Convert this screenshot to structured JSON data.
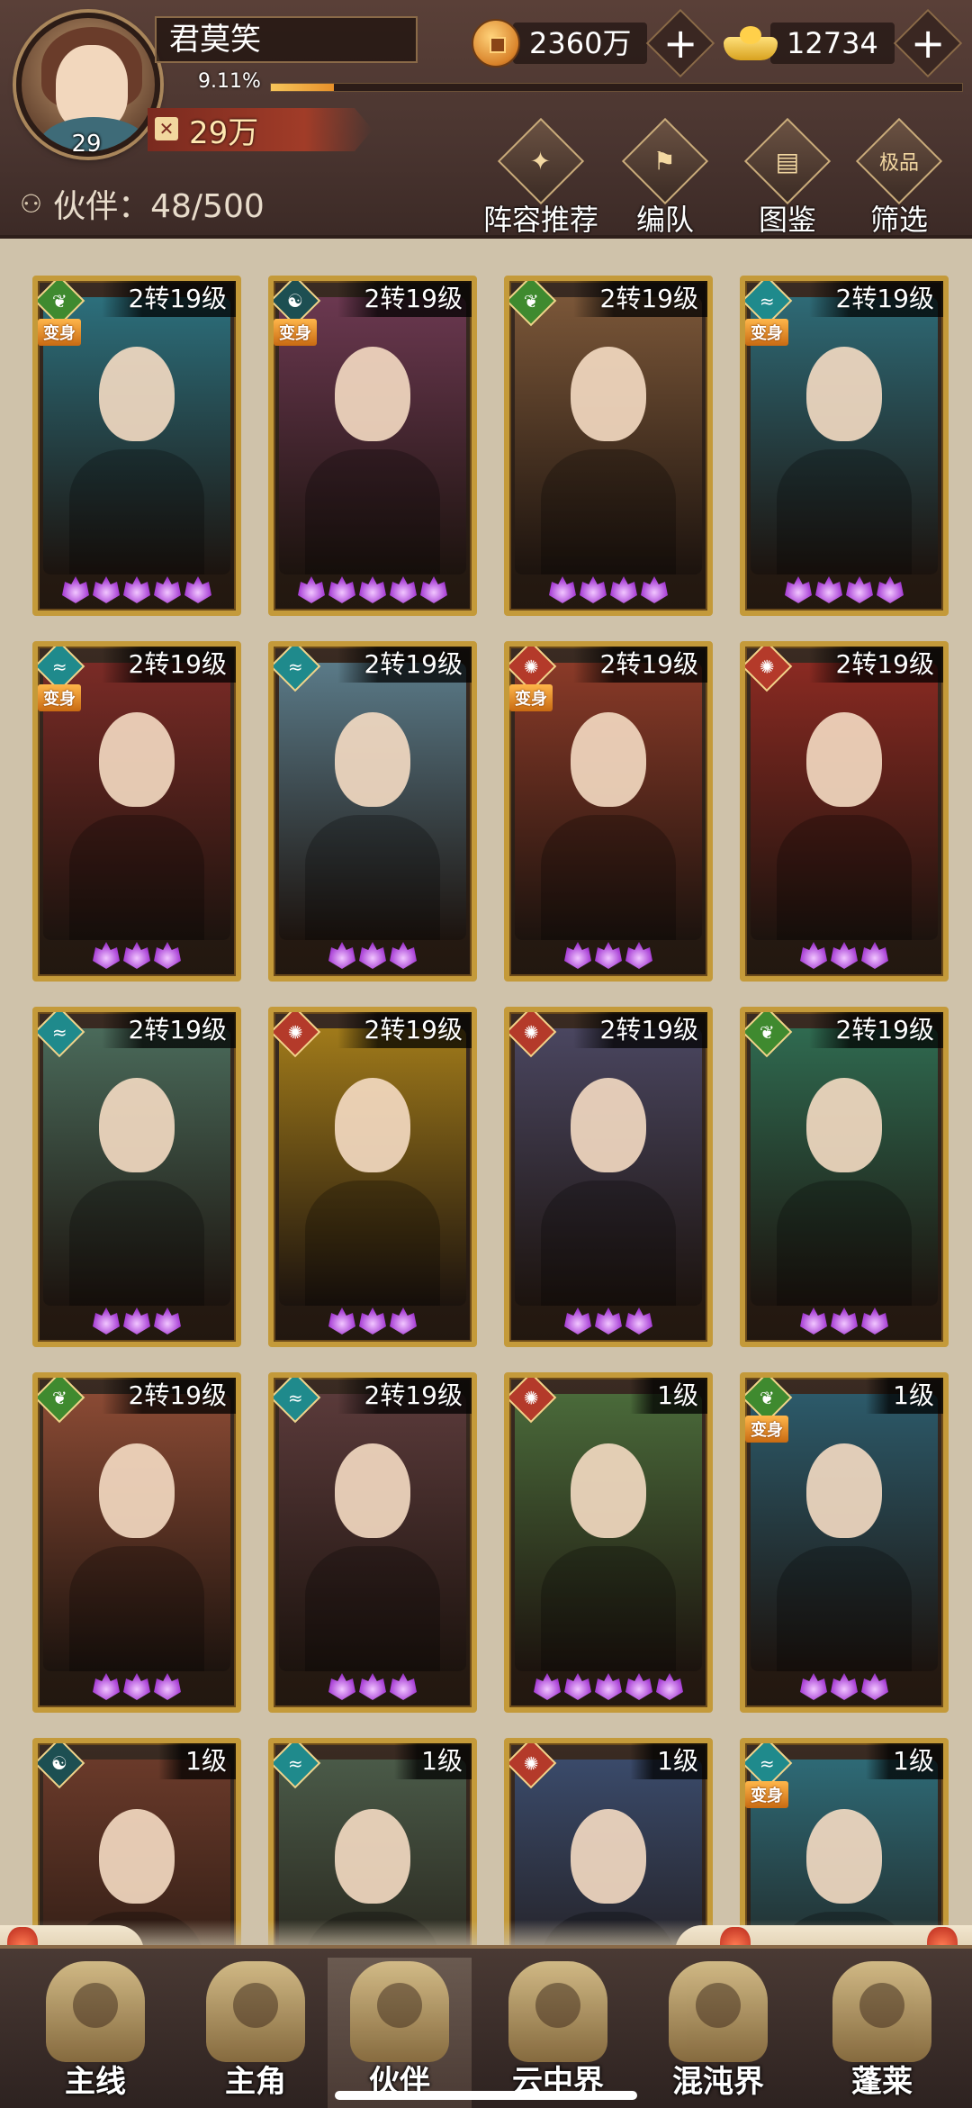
{
  "player": {
    "name": "君莫笑",
    "level": "29",
    "exp_percent_text": "9.11%",
    "exp_fraction": 0.0911,
    "power": "29万"
  },
  "currencies": {
    "copper": {
      "icon": "copper-coin-icon",
      "amount": "2360万"
    },
    "gold": {
      "icon": "gold-ingot-icon",
      "amount": "12734"
    }
  },
  "partners": {
    "label": "伙伴：48/500"
  },
  "actions": [
    {
      "label": "阵容推荐",
      "icon": "lineup-recommend-icon",
      "glyph": "✦"
    },
    {
      "label": "编队",
      "icon": "formation-flag-icon",
      "glyph": "⚑"
    },
    {
      "label": "图鉴",
      "icon": "codex-scroll-icon",
      "glyph": "▤"
    },
    {
      "label": "筛选",
      "icon": "filter-icon",
      "glyph": "极品"
    }
  ],
  "cards": [
    {
      "level": "2转19级",
      "element": "wood",
      "transform": true,
      "stars": 5,
      "color": "#2c6f7c"
    },
    {
      "level": "2转19级",
      "element": "dark",
      "transform": true,
      "stars": 5,
      "color": "#6b3850"
    },
    {
      "level": "2转19级",
      "element": "wood",
      "transform": false,
      "stars": 4,
      "color": "#7a5638"
    },
    {
      "level": "2转19级",
      "element": "water",
      "transform": true,
      "stars": 4,
      "color": "#2e6a76"
    },
    {
      "level": "2转19级",
      "element": "water",
      "transform": true,
      "stars": 3,
      "color": "#7a2b26"
    },
    {
      "level": "2转19级",
      "element": "water",
      "transform": false,
      "stars": 3,
      "color": "#5a7a88"
    },
    {
      "level": "2转19级",
      "element": "fire",
      "transform": true,
      "stars": 3,
      "color": "#8a3a28"
    },
    {
      "level": "2转19级",
      "element": "fire",
      "transform": false,
      "stars": 3,
      "color": "#8a2a22"
    },
    {
      "level": "2转19级",
      "element": "water",
      "transform": false,
      "stars": 3,
      "color": "#4a6a5a"
    },
    {
      "level": "2转19级",
      "element": "fire",
      "transform": false,
      "stars": 3,
      "color": "#a07a1a"
    },
    {
      "level": "2转19级",
      "element": "fire",
      "transform": false,
      "stars": 3,
      "color": "#4a4660"
    },
    {
      "level": "2转19级",
      "element": "wood",
      "transform": false,
      "stars": 3,
      "color": "#2f6a50"
    },
    {
      "level": "2转19级",
      "element": "wood",
      "transform": false,
      "stars": 3,
      "color": "#8a4a34"
    },
    {
      "level": "2转19级",
      "element": "water",
      "transform": false,
      "stars": 3,
      "color": "#5a3a3a"
    },
    {
      "level": "1级",
      "element": "fire",
      "transform": false,
      "stars": 5,
      "color": "#4a6a3a"
    },
    {
      "level": "1级",
      "element": "wood",
      "transform": true,
      "stars": 3,
      "color": "#2c5a6a"
    },
    {
      "level": "1级",
      "element": "dark",
      "transform": false,
      "stars": 0,
      "color": "#6a3a2a"
    },
    {
      "level": "1级",
      "element": "water",
      "transform": false,
      "stars": 0,
      "color": "#4a5a48"
    },
    {
      "level": "1级",
      "element": "fire",
      "transform": false,
      "stars": 0,
      "color": "#3a4a6a"
    },
    {
      "level": "1级",
      "element": "water",
      "transform": true,
      "stars": 0,
      "color": "#2e6a76"
    }
  ],
  "transform_tag": "变身",
  "nav": [
    {
      "label": "主线",
      "icon": "main-quest-icon",
      "active": false
    },
    {
      "label": "主角",
      "icon": "hero-icon",
      "active": false
    },
    {
      "label": "伙伴",
      "icon": "partner-icon",
      "active": true
    },
    {
      "label": "云中界",
      "icon": "cloud-realm-icon",
      "active": false
    },
    {
      "label": "混沌界",
      "icon": "chaos-realm-icon",
      "active": false
    },
    {
      "label": "蓬莱",
      "icon": "penglai-icon",
      "active": false
    }
  ],
  "colors": {
    "card_border": "#c49a3a",
    "header_bg": "#4a3530",
    "page_bg": "#cfc2aa",
    "star_purple": "#a941d6",
    "transform_orange": "#e08a20"
  }
}
